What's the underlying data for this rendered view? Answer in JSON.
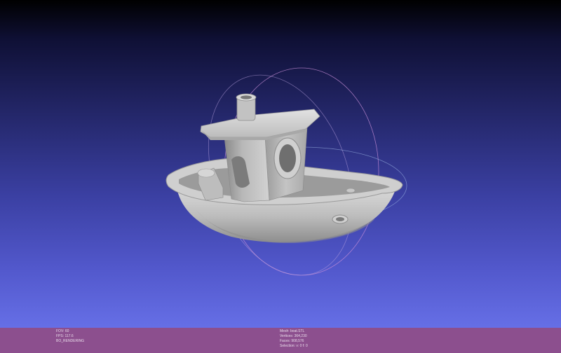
{
  "viewport": {
    "model_name": "3D Benchy boat model",
    "trackball_icon": "trackball-icon"
  },
  "status_left": {
    "lines": [
      "FOV: 60",
      "FPS:  117.6",
      "BO_RENDERING"
    ]
  },
  "status_right": {
    "lines": [
      "Mesh: boat.STL",
      "Vertices: 364,230",
      "Faces: 908,576",
      "Selection: v: 0 f: 0"
    ]
  },
  "colors": {
    "status_bar": "#8c4f8e",
    "status_text": "#e9dcea",
    "mesh": "#b4b4b4"
  }
}
